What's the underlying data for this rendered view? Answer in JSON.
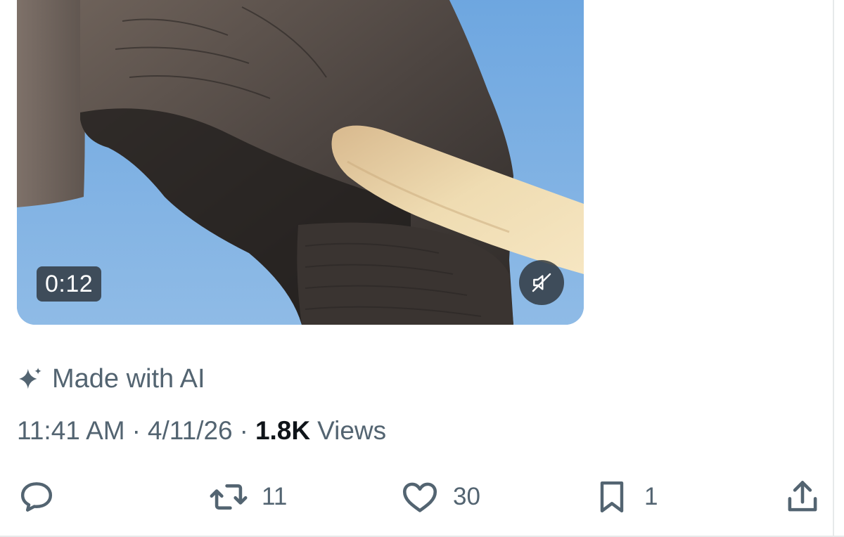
{
  "video": {
    "duration": "0:12",
    "mute_icon": "speaker-muted-icon"
  },
  "ai_label": {
    "icon": "sparkle-icon",
    "text": "Made with AI"
  },
  "meta": {
    "time": "11:41 AM",
    "separator": "·",
    "date": "4/11/26",
    "views_count": "1.8K",
    "views_label": "Views"
  },
  "actions": {
    "reply": {
      "icon": "reply-icon",
      "count": ""
    },
    "repost": {
      "icon": "repost-icon",
      "count": "11"
    },
    "like": {
      "icon": "heart-icon",
      "count": "30"
    },
    "bookmark": {
      "icon": "bookmark-icon",
      "count": "1"
    },
    "share": {
      "icon": "share-icon",
      "count": ""
    }
  },
  "colors": {
    "text_secondary": "#536471",
    "text_primary": "#0f1419",
    "sky": "#7eaedd",
    "overlay": "#2d343a"
  }
}
